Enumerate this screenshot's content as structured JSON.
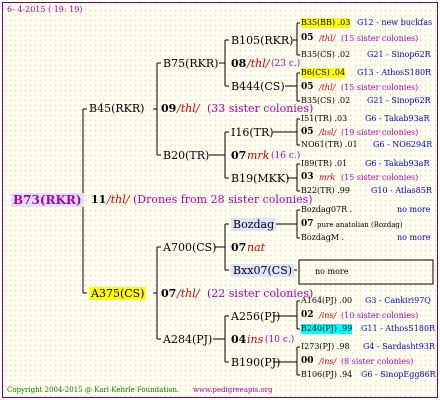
{
  "header": {
    "date_label": "6- 4-2015 ( 19: 19)"
  },
  "footer": {
    "copyright": "Copyright 2004-2015 @ Karl Kehrle Foundation.",
    "url": "www.pedigreeapis.org"
  },
  "root": {
    "name": "B73(RKR)"
  },
  "root_pedigree": {
    "number": "11",
    "sign": "/thl/",
    "note": "(Drones from 28 sister colonies)"
  },
  "gen1": {
    "sire": {
      "name": "B45(RKR)",
      "number": "09",
      "sign": "/thl/",
      "note": "(33 sister colonies)"
    },
    "dam": {
      "name": "A375(CS)",
      "number": "07",
      "sign": "/thl/",
      "note": "(22 sister colonies)"
    }
  },
  "gen2": {
    "b75": {
      "name": "B75(RKR)",
      "number": "08",
      "sign": "/thl/",
      "note": "(23 c.)"
    },
    "b20": {
      "name": "B20(TR)",
      "number": "07",
      "sign": "mrk",
      "note": "(16 c.)"
    },
    "a700": {
      "name": "A700(CS)",
      "number": "07",
      "sign": "nat"
    },
    "a284": {
      "name": "A284(PJ)",
      "number": "04",
      "sign": "ins",
      "note": "(10 c.)"
    }
  },
  "gen3": {
    "b105": {
      "name": "B105(RKR)"
    },
    "b444": {
      "name": "B444(CS)"
    },
    "i16": {
      "name": "I16(TR)"
    },
    "b19": {
      "name": "B19(MKK)"
    },
    "bozdag": {
      "name": "Bozdag"
    },
    "bxx07": {
      "name": "Bxx07(CS)",
      "note": "no more"
    },
    "a256": {
      "name": "A256(PJ)"
    },
    "b190": {
      "name": "B190(PJ)"
    }
  },
  "gen4": [
    {
      "left": "B35(BB) .03",
      "right": "G12 - new buckfas",
      "mid": {
        "number": "05",
        "sign": "/thl/",
        "note": "(15 sister colonies)"
      },
      "bottom": {
        "left": "B35(CS) .02",
        "right": "G21 - Sinop62R"
      }
    },
    {
      "left": "B6(CS) .04",
      "right": "G13 - AthosS180R",
      "mid": {
        "number": "05",
        "sign": "/thl/",
        "note": "(15 sister colonies)"
      },
      "bottom": {
        "left": "B35(CS) .02",
        "right": "G21 - Sinop62R"
      }
    },
    {
      "left": "I51(TR) .03",
      "right": "G6 - Takab93aR",
      "mid": {
        "number": "05",
        "sign": "/bsl/",
        "note": "(19 sister colonies)"
      },
      "bottom": {
        "left": "NO61(TR) .01",
        "right": "G6 - NO6294R"
      }
    },
    {
      "left": "I89(TR) .01",
      "right": "G6 - Takab93aR",
      "mid": {
        "number": "03",
        "sign": "mrk",
        "note": "(15 sister colonies)"
      },
      "bottom": {
        "left": "B22(TR) .99",
        "right": "G10 - Atlas85R"
      }
    },
    {
      "left": "Bozdag07R .",
      "right": "no more",
      "mid": {
        "number": "07",
        "sign": "",
        "note": "pure anatolian (Bozdag)"
      },
      "bottom": {
        "left": "BozdagM .",
        "right": "no more"
      }
    },
    {
      "left": "A164(PJ) .00",
      "right": "G3 - Cankiri97Q",
      "mid": {
        "number": "02",
        "sign": "/ins/",
        "note": "(10 sister colonies)"
      },
      "bottom": {
        "left": "B240(PJ) .99",
        "right": "G11 - AthosS180R"
      }
    },
    {
      "left": "I273(PJ) .98",
      "right": "G4 - Sardasht93R",
      "mid": {
        "number": "00",
        "sign": "/ins/",
        "note": "(8 sister colonies)"
      },
      "bottom": {
        "left": "B106(PJ) .94",
        "right": "G6 - SinopEgg86R"
      }
    }
  ],
  "colors": {
    "frame": "#7a0070",
    "lines": "#000000",
    "blue_text": "#0000cc",
    "magenta_text": "#aa00aa",
    "sign_red": "#cc0000",
    "highlight_yellow": "#ffff00",
    "highlight_cyan": "#00ffff"
  }
}
